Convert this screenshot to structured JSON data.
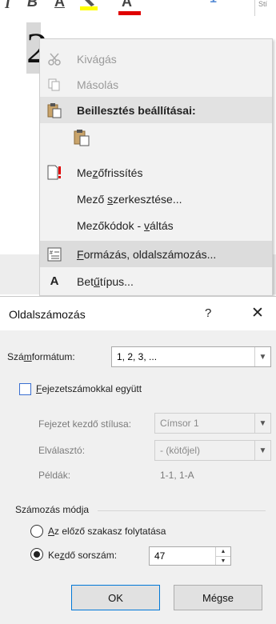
{
  "toolbar": {
    "icons": [
      "italic-icon",
      "underline-icon",
      "highlight-icon",
      "font-color-icon",
      "bullets-icon",
      "numbering-icon"
    ]
  },
  "document": {
    "numeral": "2"
  },
  "context_menu": {
    "items": [
      {
        "label": "Kivágás",
        "enabled": false,
        "icon": "cut-icon"
      },
      {
        "label": "Másolás",
        "enabled": false,
        "icon": "copy-icon"
      },
      {
        "label": "Beillesztés beállításai:",
        "header": true,
        "icon": "paste-icon"
      },
      {
        "label": "",
        "icon": "paste-keep-text-icon"
      },
      {
        "label": "Mezőfrissítés",
        "icon": "update-field-icon"
      },
      {
        "label": "Mező szerkesztése...",
        "icon": ""
      },
      {
        "label": "Mezőkódok - váltás",
        "icon": ""
      },
      {
        "label": "Formázás, oldalszámozás...",
        "highlighted": true,
        "icon": "page-number-format-icon"
      },
      {
        "label": "Betűtípus...",
        "icon": "font-icon"
      }
    ]
  },
  "dialog": {
    "title": "Oldalszámozás",
    "help_label": "?",
    "close_label": "✕",
    "number_format": {
      "label_pre": "Szá",
      "label_u": "m",
      "label_post": "formátum:",
      "value": "1, 2, 3, ..."
    },
    "chapter_checkbox": {
      "label_u": "F",
      "label_post": "ejezetszámokkal együtt",
      "checked": false
    },
    "chapter_style": {
      "label": "Fejezet kezdő stílusa:",
      "value": "Címsor 1"
    },
    "separator": {
      "label": "Elválasztó:",
      "value": "-  (kötőjel)"
    },
    "examples": {
      "label": "Példák:",
      "value": "1-1, 1-A"
    },
    "numbering_group": "Számozás módja",
    "continue_radio": {
      "label_u": "A",
      "label_post": "z előző szakasz folytatása",
      "checked": false
    },
    "start_radio": {
      "label_pre": "Ke",
      "label_u": "z",
      "label_post": "dő sorszám:",
      "checked": true
    },
    "start_value": "47",
    "ok_label": "OK",
    "cancel_label": "Mégse"
  },
  "colors": {
    "accent": "#0078d7",
    "checkbox_border": "#3a6fd1",
    "highlight_yellow": "#ffff00",
    "font_red": "#e00000"
  }
}
